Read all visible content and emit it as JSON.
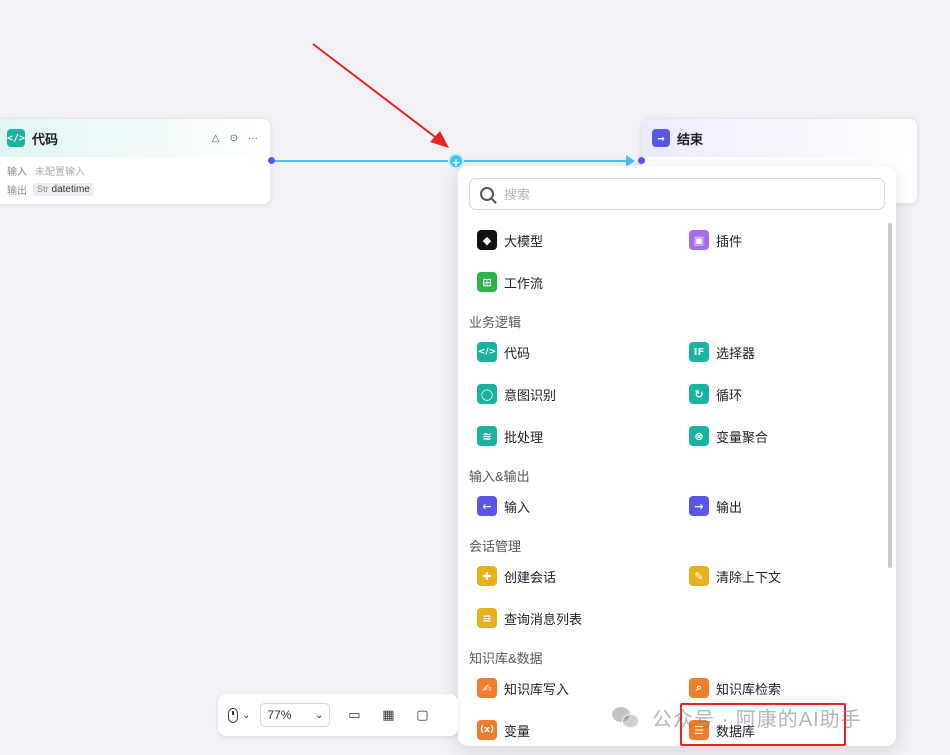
{
  "nodes": {
    "code": {
      "title": "代码",
      "icon": "</>",
      "input_label": "输入",
      "input_value": "未配置输入",
      "output_label": "输出",
      "output_type": "Str",
      "output_value": "datetime"
    },
    "end": {
      "title": "结束",
      "icon": "→"
    }
  },
  "panel": {
    "search_placeholder": "搜索",
    "top_items": [
      {
        "label": "大模型",
        "icon": "llm-icon",
        "color": "#111111"
      },
      {
        "label": "插件",
        "icon": "plugin-icon",
        "color": "#a96cf0"
      },
      {
        "label": "工作流",
        "icon": "workflow-icon",
        "color": "#2db34a"
      }
    ],
    "sections": [
      {
        "title": "业务逻辑",
        "items": [
          {
            "label": "代码",
            "color": "#17b3a3"
          },
          {
            "label": "选择器",
            "color": "#17b3a3"
          },
          {
            "label": "意图识别",
            "color": "#17b3a3"
          },
          {
            "label": "循环",
            "color": "#17b3a3"
          },
          {
            "label": "批处理",
            "color": "#17b3a3"
          },
          {
            "label": "变量聚合",
            "color": "#17b3a3"
          }
        ]
      },
      {
        "title": "输入&输出",
        "items": [
          {
            "label": "输入",
            "color": "#5a57e6"
          },
          {
            "label": "输出",
            "color": "#5a57e6"
          }
        ]
      },
      {
        "title": "会话管理",
        "items": [
          {
            "label": "创建会话",
            "color": "#e6b21a"
          },
          {
            "label": "清除上下文",
            "color": "#e6b21a"
          },
          {
            "label": "查询消息列表",
            "color": "#e6b21a"
          }
        ]
      },
      {
        "title": "知识库&数据",
        "items": [
          {
            "label": "知识库写入",
            "color": "#f07d2a"
          },
          {
            "label": "知识库检索",
            "color": "#f07d2a"
          },
          {
            "label": "变量",
            "color": "#f07d2a"
          },
          {
            "label": "数据库",
            "color": "#f07d2a"
          }
        ]
      }
    ]
  },
  "toolbar": {
    "zoom": "77%"
  },
  "watermark": {
    "text": "公众号 · 阿康的AI助手"
  }
}
